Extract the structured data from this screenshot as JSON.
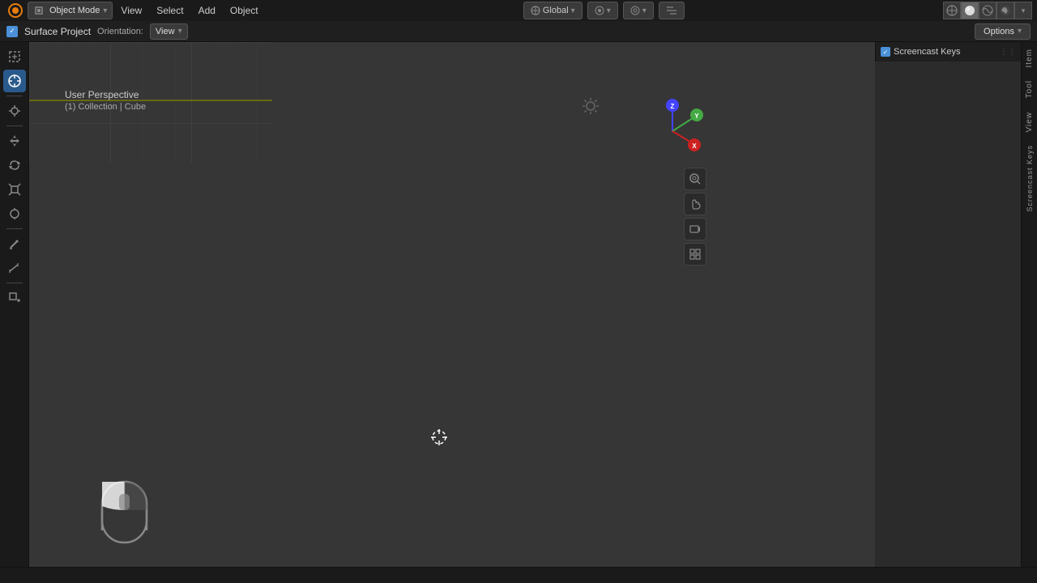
{
  "topbar": {
    "mode": "Object Mode",
    "view_label": "View",
    "select_label": "Select",
    "add_label": "Add",
    "object_label": "Object",
    "global_label": "Global",
    "chevron": "▾"
  },
  "header": {
    "project_name": "Surface Project",
    "orientation_label": "Orientation:",
    "orientation_value": "View",
    "options_label": "Options"
  },
  "viewport": {
    "perspective_label": "User Perspective",
    "collection_label": "(1) Collection | Cube"
  },
  "screencast": {
    "label": "Screencast Keys"
  },
  "sidebar": {
    "item_label": "Item",
    "tool_label": "Tool",
    "view_label": "View",
    "screencast_label": "Screencast Keys"
  },
  "statusbar": {
    "text": ""
  },
  "icons": {
    "select_box": "⬜",
    "cursor": "⊕",
    "move": "✛",
    "rotate": "↻",
    "scale": "⊞",
    "transform": "⬡",
    "annotate": "✏",
    "measure": "📐",
    "add_object": "⊕",
    "check": "✓",
    "arrow_down": "▾"
  }
}
